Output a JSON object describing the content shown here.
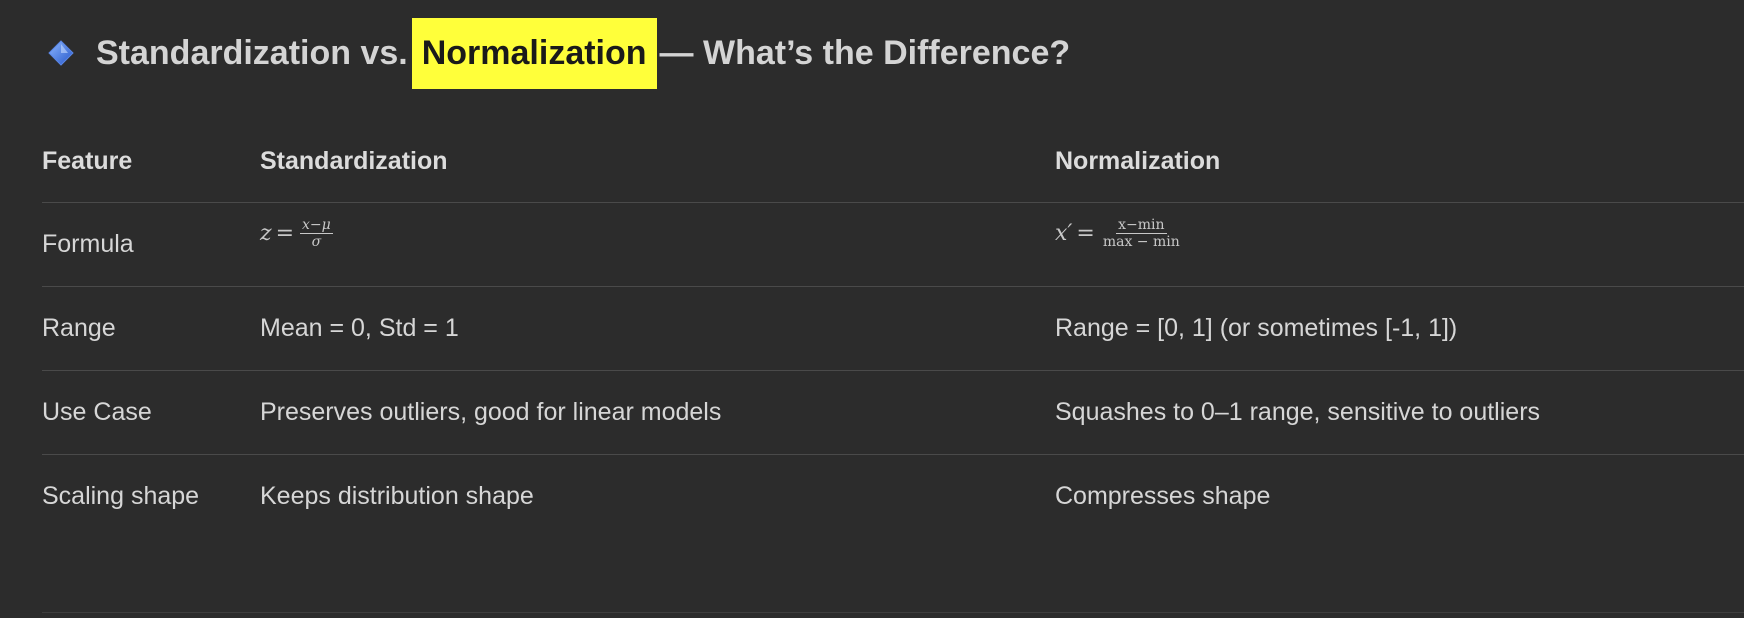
{
  "heading": {
    "icon": "blue-diamond-icon",
    "part1": "Standardization vs.",
    "highlight": "Normalization",
    "part2": "— What’s the Difference?",
    "highlight_color": "#ffff3a"
  },
  "table": {
    "headers": [
      "Feature",
      "Standardization",
      "Normalization"
    ],
    "formula": {
      "label": "Formula",
      "std": {
        "lhs": "z",
        "eq": "=",
        "num": "x−μ",
        "den": "σ"
      },
      "norm": {
        "lhs": "x′",
        "eq": "=",
        "num": "x−min",
        "den": "max − min"
      }
    },
    "rows": [
      {
        "feature": "Range",
        "std": "Mean = 0, Std = 1",
        "norm": "Range = [0, 1] (or sometimes [-1, 1])"
      },
      {
        "feature": "Use Case",
        "std": "Preserves outliers, good for linear models",
        "norm": "Squashes to 0–1 range, sensitive to outliers"
      },
      {
        "feature": "Scaling shape",
        "std": "Keeps distribution shape",
        "norm": "Compresses shape"
      }
    ]
  }
}
